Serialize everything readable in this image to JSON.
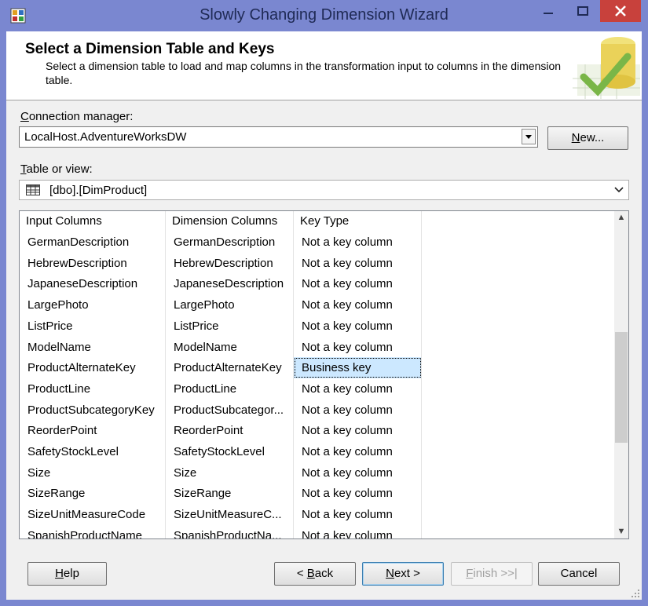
{
  "window": {
    "title": "Slowly Changing Dimension Wizard",
    "controls": {
      "minimize": "—",
      "maximize": "☐",
      "close": "✕"
    }
  },
  "header": {
    "title": "Select a Dimension Table and Keys",
    "description": "Select a dimension table to load and map columns in the transformation input to columns in the dimension table."
  },
  "connection": {
    "label_access": "C",
    "label_rest": "onnection manager:",
    "value": "LocalHost.AdventureWorksDW",
    "new_button_access": "N",
    "new_button_rest": "ew..."
  },
  "table": {
    "label_access": "T",
    "label_rest": "able or view:",
    "value": "[dbo].[DimProduct]"
  },
  "grid": {
    "columns": [
      "Input Columns",
      "Dimension Columns",
      "Key Type"
    ],
    "rows": [
      {
        "input": "GermanDescription",
        "dimension": "GermanDescription",
        "key": "Not a key column"
      },
      {
        "input": "HebrewDescription",
        "dimension": "HebrewDescription",
        "key": "Not a key column"
      },
      {
        "input": "JapaneseDescription",
        "dimension": "JapaneseDescription",
        "key": "Not a key column"
      },
      {
        "input": "LargePhoto",
        "dimension": "LargePhoto",
        "key": "Not a key column"
      },
      {
        "input": "ListPrice",
        "dimension": "ListPrice",
        "key": "Not a key column"
      },
      {
        "input": "ModelName",
        "dimension": "ModelName",
        "key": "Not a key column"
      },
      {
        "input": "ProductAlternateKey",
        "dimension": "ProductAlternateKey",
        "key": "Business key"
      },
      {
        "input": "ProductLine",
        "dimension": "ProductLine",
        "key": "Not a key column"
      },
      {
        "input": "ProductSubcategoryKey",
        "dimension": "ProductSubcategor...",
        "key": "Not a key column"
      },
      {
        "input": "ReorderPoint",
        "dimension": "ReorderPoint",
        "key": "Not a key column"
      },
      {
        "input": "SafetyStockLevel",
        "dimension": "SafetyStockLevel",
        "key": "Not a key column"
      },
      {
        "input": "Size",
        "dimension": "Size",
        "key": "Not a key column"
      },
      {
        "input": "SizeRange",
        "dimension": "SizeRange",
        "key": "Not a key column"
      },
      {
        "input": "SizeUnitMeasureCode",
        "dimension": "SizeUnitMeasureC...",
        "key": "Not a key column"
      },
      {
        "input": "SpanishProductName",
        "dimension": "SpanishProductNa...",
        "key": "Not a key column"
      }
    ]
  },
  "buttons": {
    "help_access": "H",
    "help_rest": "elp",
    "back_prefix": "< ",
    "back_access": "B",
    "back_rest": "ack",
    "next_access": "N",
    "next_rest": "ext >",
    "finish_access": "F",
    "finish_rest": "inish >>|",
    "cancel": "Cancel"
  },
  "colors": {
    "titlebar": "#7a87d0",
    "close": "#c8413c",
    "selection": "#cce8ff"
  }
}
